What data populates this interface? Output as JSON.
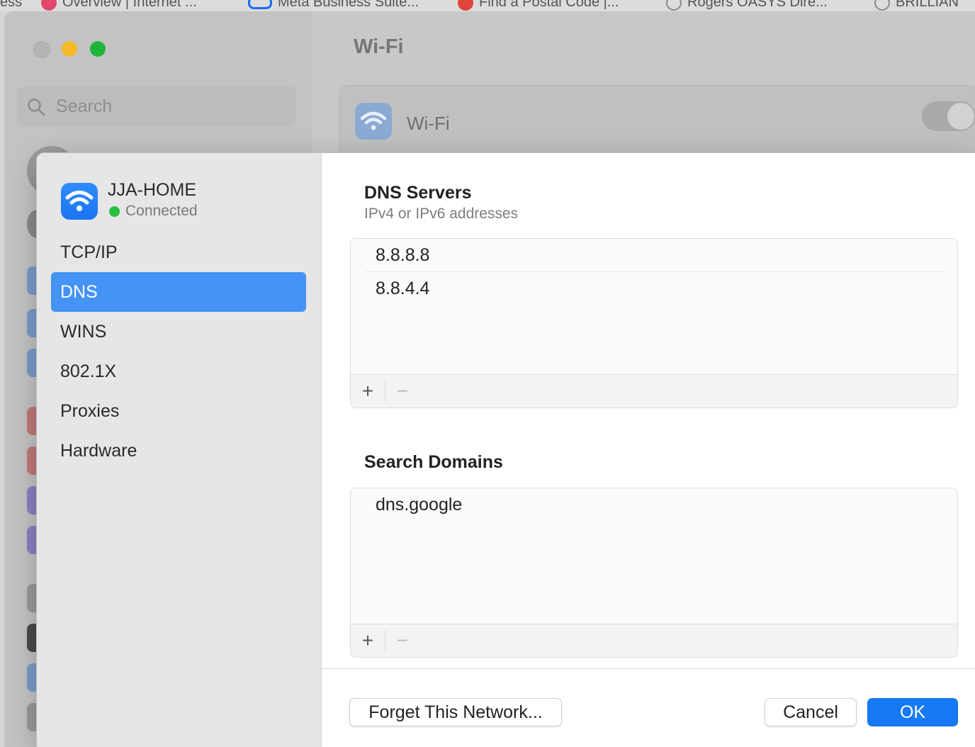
{
  "bookmarks": [
    {
      "label": "ess",
      "color": ""
    },
    {
      "label": "Overview | Internet ...",
      "color": "#e0476a"
    },
    {
      "label": "Meta Business Suite...",
      "color": "#1a6cf0"
    },
    {
      "label": "Find a Postal Code |...",
      "color": "#e0453a"
    },
    {
      "label": "Rogers OASYS Dire...",
      "color": "#8a8a8a"
    },
    {
      "label": "BRILLIAN",
      "color": "#8a8a8a"
    }
  ],
  "settings": {
    "title": "Wi-Fi",
    "search_placeholder": "Search",
    "wifi_row_label": "Wi-Fi"
  },
  "sheet": {
    "network_name": "JJA-HOME",
    "network_status": "Connected",
    "nav": [
      "TCP/IP",
      "DNS",
      "WINS",
      "802.1X",
      "Proxies",
      "Hardware"
    ],
    "active_nav": "DNS",
    "dns": {
      "title": "DNS Servers",
      "subtitle": "IPv4 or IPv6 addresses",
      "servers": [
        "8.8.8.8",
        "8.8.4.4"
      ]
    },
    "search_domains": {
      "title": "Search Domains",
      "domains": [
        "dns.google"
      ]
    },
    "add_label": "+",
    "remove_label": "−",
    "forget_label": "Forget This Network...",
    "cancel_label": "Cancel",
    "ok_label": "OK"
  },
  "colors": {
    "accent": "#1679f5",
    "selection": "#4593f5",
    "connected": "#27c03f"
  }
}
